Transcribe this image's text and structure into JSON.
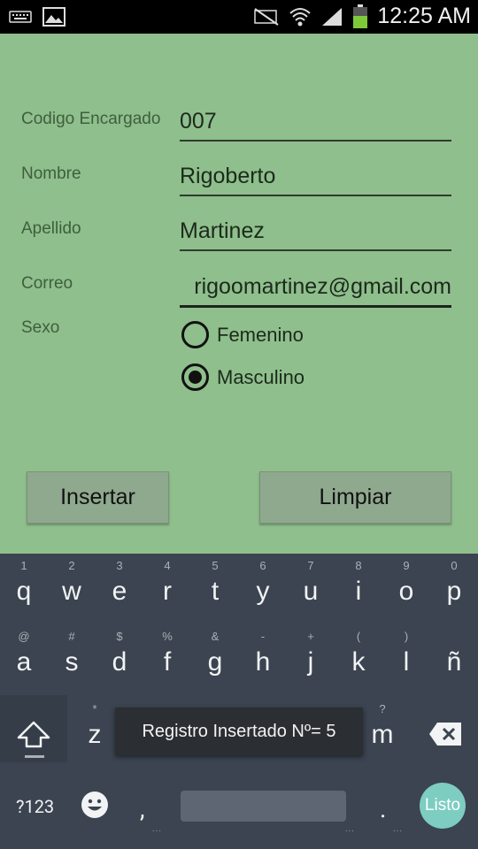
{
  "status_bar": {
    "time": "12:25 AM",
    "icons": [
      "keyboard-icon",
      "image-icon",
      "mute-icon",
      "wifi-icon",
      "signal-icon",
      "battery-icon"
    ],
    "battery_color": "#7ec93a"
  },
  "form": {
    "fields": [
      {
        "label": "Codigo Encargado",
        "value": "007"
      },
      {
        "label": "Nombre",
        "value": "Rigoberto"
      },
      {
        "label": "Apellido",
        "value": "Martinez"
      },
      {
        "label": "Correo",
        "value": "rigoomartinez@gmail.com"
      }
    ],
    "sex_label": "Sexo",
    "sex_options": [
      {
        "label": "Femenino",
        "checked": false
      },
      {
        "label": "Masculino",
        "checked": true
      }
    ],
    "insert_button": "Insertar",
    "clear_button": "Limpiar",
    "background": "#8fbf8c"
  },
  "keyboard": {
    "row1": [
      {
        "key": "q",
        "hint": "1"
      },
      {
        "key": "w",
        "hint": "2"
      },
      {
        "key": "e",
        "hint": "3"
      },
      {
        "key": "r",
        "hint": "4"
      },
      {
        "key": "t",
        "hint": "5"
      },
      {
        "key": "y",
        "hint": "6"
      },
      {
        "key": "u",
        "hint": "7"
      },
      {
        "key": "i",
        "hint": "8"
      },
      {
        "key": "o",
        "hint": "9"
      },
      {
        "key": "p",
        "hint": "0"
      }
    ],
    "row2": [
      {
        "key": "a",
        "hint": "@"
      },
      {
        "key": "s",
        "hint": "#"
      },
      {
        "key": "d",
        "hint": "$"
      },
      {
        "key": "f",
        "hint": "%"
      },
      {
        "key": "g",
        "hint": "&"
      },
      {
        "key": "h",
        "hint": "-"
      },
      {
        "key": "j",
        "hint": "+"
      },
      {
        "key": "k",
        "hint": "("
      },
      {
        "key": "l",
        "hint": ")"
      },
      {
        "key": "ñ",
        "hint": ""
      }
    ],
    "row3": [
      {
        "key": "z",
        "hint": "*"
      },
      {
        "key": "m",
        "hint": "?"
      }
    ],
    "symbols_key": "?123",
    "comma_key": ",",
    "period_key": ".",
    "done_key": "Listo",
    "background": "#3b4450"
  },
  "toast": {
    "message": "Registro Insertado Nº= 5"
  }
}
